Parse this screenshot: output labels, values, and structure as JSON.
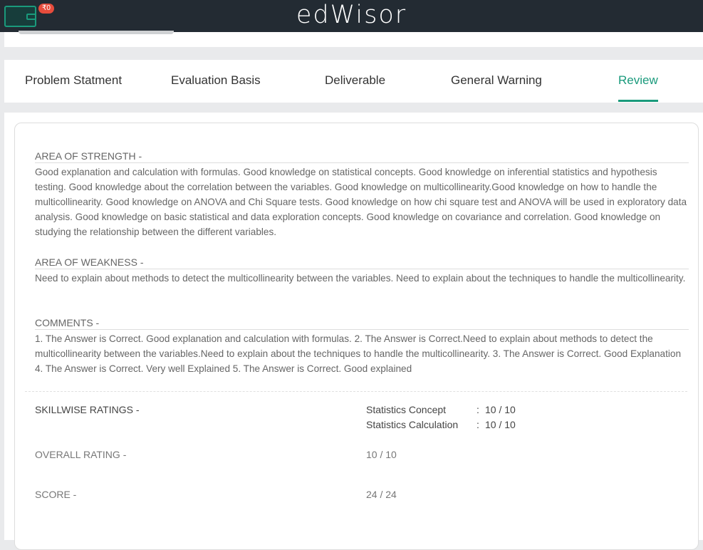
{
  "header": {
    "logo": "edWisor",
    "wallet_badge": "₹0"
  },
  "tabs": [
    {
      "label": "Problem Statment"
    },
    {
      "label": "Evaluation Basis"
    },
    {
      "label": "Deliverable"
    },
    {
      "label": "General Warning"
    },
    {
      "label": "Review",
      "active": true
    }
  ],
  "review": {
    "strength": {
      "heading": "AREA OF STRENGTH -",
      "text": "Good explanation and calculation with formulas. Good knowledge on statistical concepts. Good knowledge on inferential statistics and hypothesis testing. Good knowledge about the correlation between the variables. Good knowledge on multicollinearity.Good knowledge on how to handle the multicollinearity. Good knowledge on ANOVA and Chi Square tests. Good knowledge on how chi square test and ANOVA will be used in exploratory data analysis. Good knowledge on basic statistical and data exploration concepts. Good knowledge on covariance and correlation. Good knowledge on studying the relationship between the different variables."
    },
    "weakness": {
      "heading": "AREA OF WEAKNESS -",
      "text": "Need to explain about methods to detect the multicollinearity between the variables. Need to explain about the techniques to handle the multicollinearity."
    },
    "comments": {
      "heading": "COMMENTS -",
      "text": "1. The Answer is Correct. Good explanation and calculation with formulas. 2. The Answer is Correct.Need to explain about methods to detect the multicollinearity between the variables.Need to explain about the techniques to handle the multicollinearity. 3. The Answer is Correct. Good Explanation 4. The Answer is Correct. Very well Explained 5. The Answer is Correct. Good explained"
    },
    "skillwise": {
      "label": "SKILLWISE RATINGS -",
      "items": [
        {
          "name": "Statistics Concept",
          "sep": ":",
          "value": "10 / 10"
        },
        {
          "name": "Statistics Calculation",
          "sep": ":",
          "value": "10 / 10"
        }
      ]
    },
    "overall": {
      "label": "OVERALL RATING -",
      "value": "10 / 10"
    },
    "score": {
      "label": "SCORE -",
      "value": "24 / 24"
    }
  },
  "colors": {
    "accent": "#1a9a7c",
    "topbar": "#232b33",
    "badge": "#e74c3c"
  }
}
